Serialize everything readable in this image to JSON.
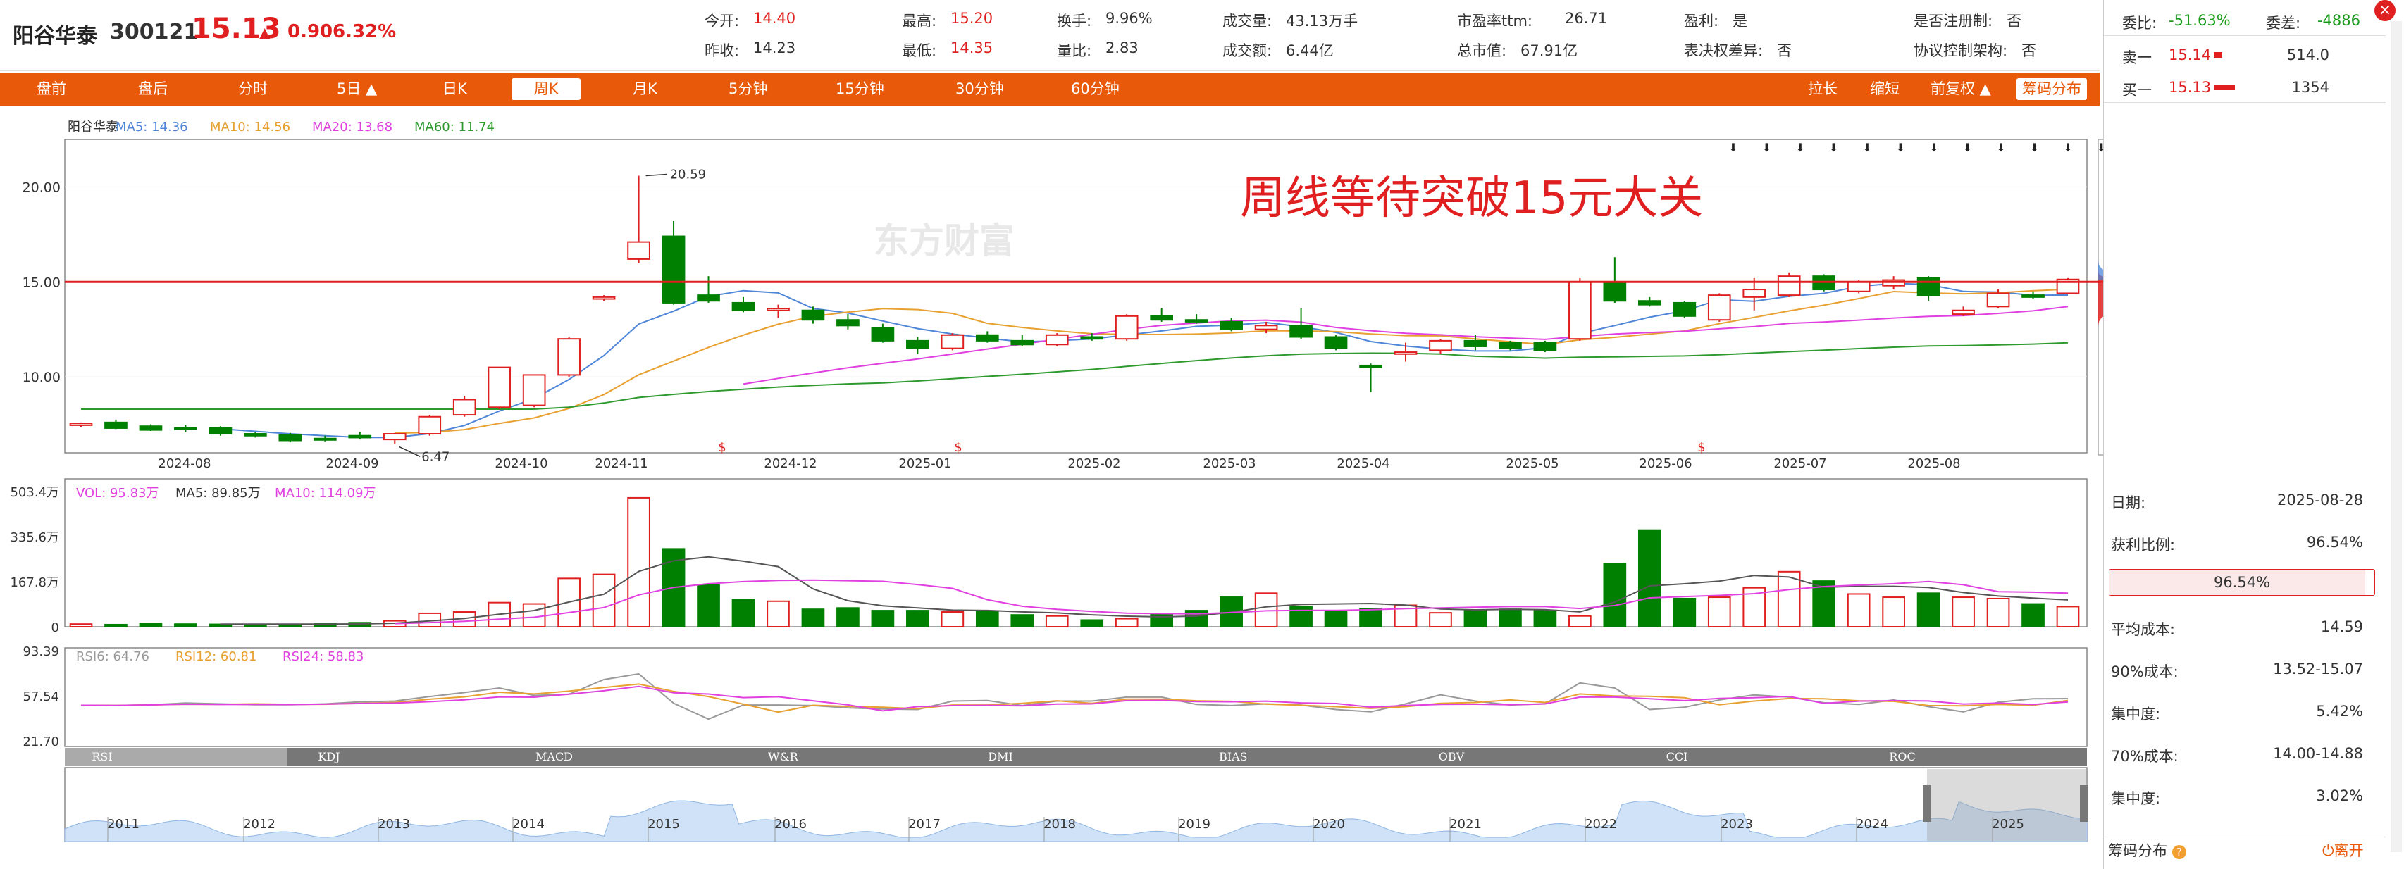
{
  "stock": {
    "name": "阳谷华泰",
    "code": "300121",
    "price": "15.13",
    "arrow": "▲",
    "change": "0.90",
    "pct": "6.32%"
  },
  "quote": [
    {
      "label": "今开:",
      "value": "14.40",
      "color": "red"
    },
    {
      "label": "昨收:",
      "value": "14.23",
      "color": "dark"
    },
    {
      "label": "最高:",
      "value": "15.20",
      "color": "red"
    },
    {
      "label": "最低:",
      "value": "14.35",
      "color": "red"
    },
    {
      "label": "换手:",
      "value": "9.96%",
      "color": "dark"
    },
    {
      "label": "量比:",
      "value": "2.83",
      "color": "dark"
    },
    {
      "label": "成交量:",
      "value": "43.13万手",
      "color": "dark"
    },
    {
      "label": "成交额:",
      "value": "6.44亿",
      "color": "dark"
    },
    {
      "label": "市盈率ttm:",
      "value": "26.71",
      "color": "dark"
    },
    {
      "label": "总市值:",
      "value": "67.91亿",
      "color": "dark"
    },
    {
      "label": "盈利:",
      "value": "是",
      "color": "dark"
    },
    {
      "label": "表决权差异:",
      "value": "否",
      "color": "dark"
    },
    {
      "label": "是否注册制:",
      "value": "否",
      "color": "dark"
    },
    {
      "label": "协议控制架构:",
      "value": "否",
      "color": "dark"
    }
  ],
  "toolbar": {
    "left": [
      "盘前",
      "盘后",
      "分时",
      "5日 ▲",
      "日K",
      "周K",
      "月K",
      "5分钟",
      "15分钟",
      "30分钟",
      "60分钟"
    ],
    "active": "周K",
    "right": [
      "拉长",
      "缩短",
      "前复权 ▲",
      "筹码分布"
    ]
  },
  "orderbook": {
    "weibi_label": "委比:",
    "weibi_value": "-51.63%",
    "weicha_label": "委差:",
    "weicha_value": "-4886",
    "sell1_label": "卖一",
    "sell1_price": "15.14",
    "sell1_vol": "514.0",
    "buy1_label": "买一",
    "buy1_price": "15.13",
    "buy1_vol": "1354"
  },
  "chip": {
    "rows": [
      {
        "label": "日期:",
        "value": "2025-08-28"
      },
      {
        "label": "获利比例:",
        "value": "96.54%"
      }
    ],
    "bar_value": "96.54%",
    "bar_fraction": 0.9654,
    "rows2": [
      {
        "label": "平均成本:",
        "value": "14.59"
      },
      {
        "label": "90%成本:",
        "value": "13.52-15.07"
      },
      {
        "label": "集中度:",
        "value": "5.42%"
      },
      {
        "label": "70%成本:",
        "value": "14.00-14.88"
      },
      {
        "label": "集中度:",
        "value": "3.02%"
      }
    ],
    "footer_label": "筹码分布",
    "footer_exit": "离开"
  },
  "close_icon": "×",
  "colors": {
    "up": "#e02020",
    "down": "#008000",
    "ma5": "#4f86d8",
    "ma10": "#e8a030",
    "ma20": "#e040e0",
    "ma60": "#2e9a2e",
    "accent": "#e85a0a"
  },
  "chart_data": [
    {
      "type": "candlestick",
      "legend": [
        {
          "text": "阳谷华泰",
          "color": "#333"
        },
        {
          "text": "MA5: 14.36",
          "color": "#4f86d8"
        },
        {
          "text": "MA10: 14.56",
          "color": "#e8a030"
        },
        {
          "text": "MA20: 13.68",
          "color": "#e040e0"
        },
        {
          "text": "MA60: 11.74",
          "color": "#2e9a2e"
        }
      ],
      "y_ticks": [
        "20.00",
        "15.00",
        "10.00"
      ],
      "ylim": [
        6,
        22.5
      ],
      "x_ticks": [
        "2024-08",
        "2024-09",
        "2024-10",
        "2024-11",
        "2024-12",
        "2025-01",
        "2025-02",
        "2025-03",
        "2025-04",
        "2025-05",
        "2025-06",
        "2025-07",
        "2025-08"
      ],
      "annotations": [
        "20.59",
        "6.47"
      ],
      "hline": 15.0,
      "text_overlay": "周线等待突破15元大关",
      "watermark": "东方财富",
      "ohlc": [
        [
          7.45,
          7.6,
          7.35,
          7.55
        ],
        [
          7.6,
          7.75,
          7.25,
          7.3
        ],
        [
          7.4,
          7.5,
          7.15,
          7.2
        ],
        [
          7.3,
          7.45,
          7.1,
          7.25
        ],
        [
          7.3,
          7.4,
          6.9,
          7.0
        ],
        [
          7.0,
          7.1,
          6.8,
          6.9
        ],
        [
          6.95,
          7.05,
          6.55,
          6.65
        ],
        [
          6.75,
          6.9,
          6.6,
          6.7
        ],
        [
          6.9,
          7.1,
          6.7,
          6.8
        ],
        [
          6.7,
          7.05,
          6.47,
          7.0
        ],
        [
          7.0,
          8.0,
          6.9,
          7.9
        ],
        [
          8.0,
          9.0,
          7.9,
          8.8
        ],
        [
          8.4,
          10.5,
          8.3,
          10.5
        ],
        [
          8.5,
          10.0,
          8.4,
          10.1
        ],
        [
          10.1,
          12.1,
          10.0,
          12.0
        ],
        [
          14.1,
          14.3,
          14.0,
          14.2
        ],
        [
          16.2,
          20.59,
          16.0,
          17.1
        ],
        [
          17.4,
          18.2,
          13.8,
          13.9
        ],
        [
          14.3,
          15.3,
          13.9,
          14.0
        ],
        [
          13.9,
          14.2,
          13.4,
          13.5
        ],
        [
          13.5,
          13.8,
          13.1,
          13.6
        ],
        [
          13.5,
          13.7,
          12.8,
          13.0
        ],
        [
          13.0,
          13.3,
          12.5,
          12.7
        ],
        [
          12.6,
          12.8,
          11.8,
          11.9
        ],
        [
          11.9,
          12.1,
          11.2,
          11.5
        ],
        [
          11.5,
          12.3,
          11.4,
          12.2
        ],
        [
          12.2,
          12.4,
          11.8,
          11.9
        ],
        [
          11.9,
          12.2,
          11.6,
          11.7
        ],
        [
          11.7,
          12.3,
          11.6,
          12.2
        ],
        [
          12.1,
          12.3,
          11.9,
          12.0
        ],
        [
          12.0,
          13.3,
          11.9,
          13.2
        ],
        [
          13.2,
          13.6,
          12.9,
          13.0
        ],
        [
          13.0,
          13.3,
          12.8,
          12.9
        ],
        [
          12.9,
          13.1,
          12.4,
          12.5
        ],
        [
          12.5,
          12.9,
          12.3,
          12.7
        ],
        [
          12.7,
          13.6,
          12.0,
          12.1
        ],
        [
          12.1,
          12.2,
          11.4,
          11.5
        ],
        [
          10.6,
          10.7,
          9.2,
          10.5
        ],
        [
          11.2,
          11.8,
          10.8,
          11.3
        ],
        [
          11.4,
          12.0,
          11.2,
          11.9
        ],
        [
          11.9,
          12.2,
          11.4,
          11.6
        ],
        [
          11.8,
          11.9,
          11.4,
          11.5
        ],
        [
          11.8,
          11.9,
          11.3,
          11.4
        ],
        [
          12.0,
          15.2,
          11.9,
          15.0
        ],
        [
          15.0,
          16.3,
          13.9,
          14.0
        ],
        [
          14.0,
          14.2,
          13.7,
          13.8
        ],
        [
          13.9,
          14.0,
          13.1,
          13.2
        ],
        [
          13.0,
          14.4,
          12.9,
          14.3
        ],
        [
          14.2,
          15.2,
          13.5,
          14.6
        ],
        [
          14.3,
          15.5,
          14.2,
          15.3
        ],
        [
          15.3,
          15.4,
          14.5,
          14.6
        ],
        [
          14.5,
          15.1,
          14.4,
          15.0
        ],
        [
          14.8,
          15.3,
          14.6,
          15.1
        ],
        [
          15.2,
          15.3,
          14.0,
          14.3
        ],
        [
          13.3,
          13.7,
          13.2,
          13.5
        ],
        [
          13.7,
          14.6,
          13.6,
          14.4
        ],
        [
          14.3,
          14.5,
          14.1,
          14.2
        ],
        [
          14.4,
          15.2,
          14.35,
          15.13
        ]
      ]
    },
    {
      "type": "bar",
      "legend": [
        {
          "text": "VOL: 95.83万",
          "color": "#e040e0"
        },
        {
          "text": "MA5: 89.85万",
          "color": "#333"
        },
        {
          "text": "MA10: 114.09万",
          "color": "#e040e0"
        }
      ],
      "y_ticks": [
        "503.4万",
        "335.6万",
        "167.8万",
        "0"
      ],
      "ylim": [
        0,
        503.4
      ],
      "values": [
        10,
        8,
        12,
        10,
        9,
        9,
        8,
        12,
        15,
        22,
        50,
        55,
        90,
        85,
        180,
        195,
        480,
        290,
        155,
        100,
        95,
        65,
        70,
        60,
        60,
        55,
        58,
        44,
        40,
        25,
        30,
        45,
        60,
        110,
        125,
        75,
        55,
        68,
        80,
        52,
        60,
        65,
        60,
        40,
        235,
        360,
        105,
        110,
        145,
        205,
        170,
        122,
        110,
        125,
        110,
        105,
        85,
        75
      ]
    },
    {
      "type": "line",
      "legend": [
        {
          "text": "RSI6: 64.76",
          "color": "#999"
        },
        {
          "text": "RSI12: 60.81",
          "color": "#e8a030"
        },
        {
          "text": "RSI24: 58.83",
          "color": "#e040e0"
        }
      ],
      "y_ticks": [
        "93.39",
        "57.54",
        "21.70"
      ],
      "ylim": [
        21.7,
        93.39
      ]
    }
  ],
  "indicator_tabs": [
    "RSI",
    "KDJ",
    "MACD",
    "W&R",
    "DMI",
    "BIAS",
    "OBV",
    "CCI",
    "ROC"
  ],
  "timeline_years": [
    "2011",
    "2012",
    "2013",
    "2014",
    "2015",
    "2016",
    "2017",
    "2018",
    "2019",
    "2020",
    "2021",
    "2022",
    "2023",
    "2024",
    "2025"
  ]
}
